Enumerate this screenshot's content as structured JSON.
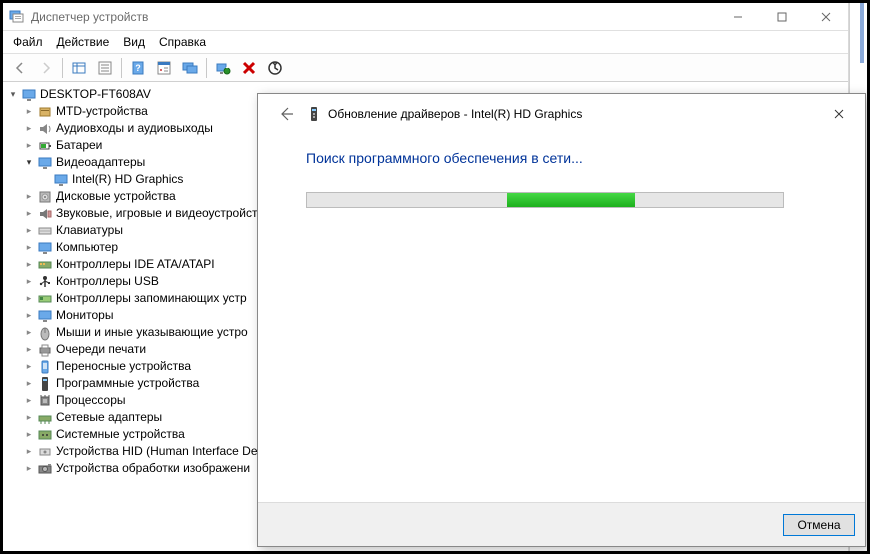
{
  "window": {
    "title": "Диспетчер устройств"
  },
  "menu": {
    "file": "Файл",
    "action": "Действие",
    "view": "Вид",
    "help": "Справка"
  },
  "toolbar_icons": {
    "back": "back-icon",
    "forward": "forward-icon",
    "show_hidden": "show-hidden-icon",
    "properties": "properties-icon",
    "help": "help-icon",
    "details": "details-icon",
    "monitors": "monitors-icon",
    "scan": "scan-hardware-icon",
    "uninstall": "uninstall-icon",
    "update": "update-driver-icon"
  },
  "tree": {
    "root": "DESKTOP-FT608AV",
    "items": [
      {
        "label": "MTD-устройства",
        "icon": "mtd"
      },
      {
        "label": "Аудиовходы и аудиовыходы",
        "icon": "audio"
      },
      {
        "label": "Батареи",
        "icon": "battery"
      },
      {
        "label": "Видеоадаптеры",
        "icon": "display",
        "expanded": true,
        "children": [
          {
            "label": "Intel(R) HD Graphics",
            "icon": "display"
          }
        ]
      },
      {
        "label": "Дисковые устройства",
        "icon": "disk"
      },
      {
        "label": "Звуковые, игровые и видеоустройст",
        "icon": "sound"
      },
      {
        "label": "Клавиатуры",
        "icon": "keyboard"
      },
      {
        "label": "Компьютер",
        "icon": "computer"
      },
      {
        "label": "Контроллеры IDE ATA/ATAPI",
        "icon": "ide"
      },
      {
        "label": "Контроллеры USB",
        "icon": "usb"
      },
      {
        "label": "Контроллеры запоминающих устр",
        "icon": "storage"
      },
      {
        "label": "Мониторы",
        "icon": "monitor"
      },
      {
        "label": "Мыши и иные указывающие устро",
        "icon": "mouse"
      },
      {
        "label": "Очереди печати",
        "icon": "printer"
      },
      {
        "label": "Переносные устройства",
        "icon": "portable"
      },
      {
        "label": "Программные устройства",
        "icon": "software"
      },
      {
        "label": "Процессоры",
        "icon": "cpu"
      },
      {
        "label": "Сетевые адаптеры",
        "icon": "network"
      },
      {
        "label": "Системные устройства",
        "icon": "system"
      },
      {
        "label": "Устройства HID (Human Interface De",
        "icon": "hid"
      },
      {
        "label": "Устройства обработки изображени",
        "icon": "imaging"
      }
    ]
  },
  "dialog": {
    "title": "Обновление драйверов - Intel(R) HD Graphics",
    "status": "Поиск программного обеспечения в сети...",
    "cancel": "Отмена"
  }
}
